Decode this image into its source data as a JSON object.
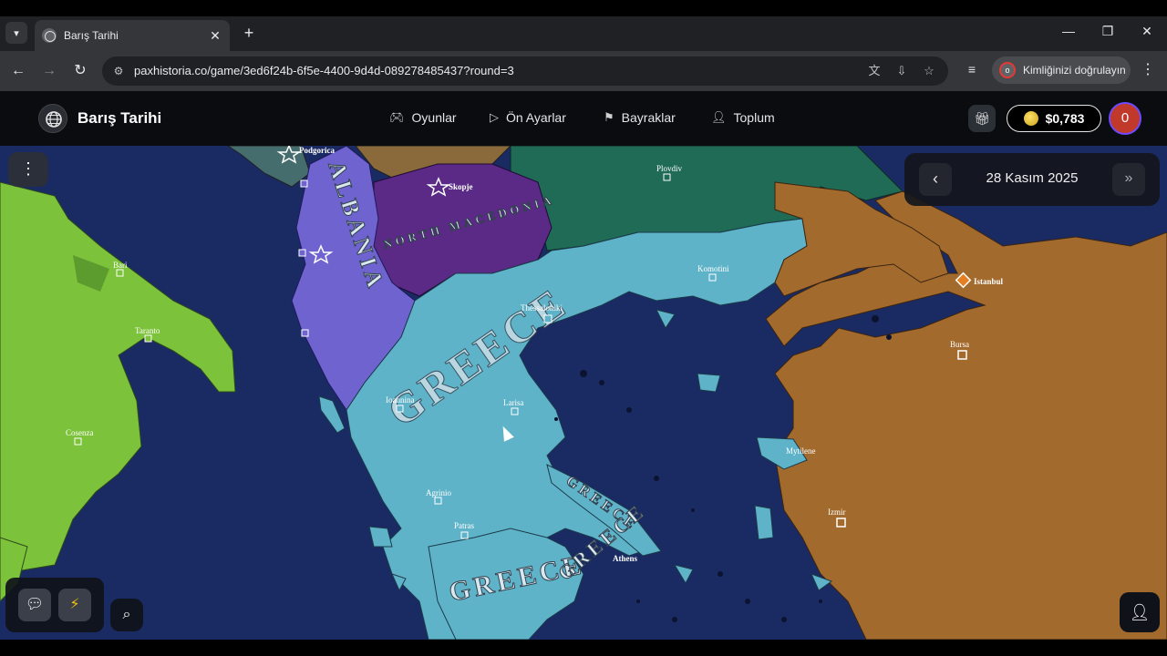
{
  "browser": {
    "tab_title": "Barış Tarihi",
    "url": "paxhistoria.co/game/3ed6f24b-6f5e-4400-9d4d-089278485437?round=3",
    "profile_label": "Kimliğinizi doğrulayın"
  },
  "app": {
    "brand": "Barış Tarihi",
    "nav": [
      {
        "label": "Oyunlar",
        "icon": "gamepad-icon"
      },
      {
        "label": "Ön Ayarlar",
        "icon": "play-icon"
      },
      {
        "label": "Bayraklar",
        "icon": "flag-icon"
      },
      {
        "label": "Toplum",
        "icon": "users-icon"
      }
    ],
    "balance": "$0,783",
    "user_badge": "0"
  },
  "date_panel": {
    "date": "28 Kasım 2025"
  },
  "map": {
    "country_labels": [
      "ALBANIA",
      "NORTH MACEDONIA",
      "GREECE"
    ],
    "capitals": [
      "Podgorica",
      "Skopje",
      "Istanbul",
      "Athens"
    ],
    "cities": [
      "Plovdiv",
      "Bari",
      "Taranto",
      "Cosenza",
      "Thessaloniki",
      "Komotini",
      "Ioannina",
      "Larisa",
      "Agrinio",
      "Patras",
      "Mytilene",
      "Bursa",
      "Izmir"
    ],
    "colors": {
      "sea": "#1a2a63",
      "italy": "#7cc23a",
      "albania": "#6f64cf",
      "north_macedonia": "#5a2a86",
      "greece": "#5fb3c9",
      "bulgaria": "#1f6b55",
      "turkey": "#a36a2e"
    }
  }
}
